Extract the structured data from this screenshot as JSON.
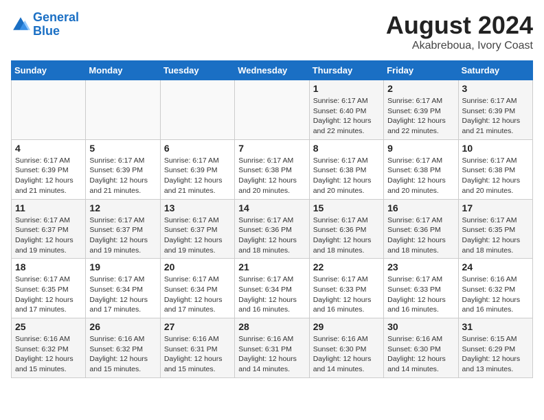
{
  "header": {
    "logo_line1": "General",
    "logo_line2": "Blue",
    "month_year": "August 2024",
    "location": "Akabreboua, Ivory Coast"
  },
  "weekdays": [
    "Sunday",
    "Monday",
    "Tuesday",
    "Wednesday",
    "Thursday",
    "Friday",
    "Saturday"
  ],
  "weeks": [
    [
      {
        "day": "",
        "info": ""
      },
      {
        "day": "",
        "info": ""
      },
      {
        "day": "",
        "info": ""
      },
      {
        "day": "",
        "info": ""
      },
      {
        "day": "1",
        "info": "Sunrise: 6:17 AM\nSunset: 6:40 PM\nDaylight: 12 hours\nand 22 minutes."
      },
      {
        "day": "2",
        "info": "Sunrise: 6:17 AM\nSunset: 6:39 PM\nDaylight: 12 hours\nand 22 minutes."
      },
      {
        "day": "3",
        "info": "Sunrise: 6:17 AM\nSunset: 6:39 PM\nDaylight: 12 hours\nand 21 minutes."
      }
    ],
    [
      {
        "day": "4",
        "info": "Sunrise: 6:17 AM\nSunset: 6:39 PM\nDaylight: 12 hours\nand 21 minutes."
      },
      {
        "day": "5",
        "info": "Sunrise: 6:17 AM\nSunset: 6:39 PM\nDaylight: 12 hours\nand 21 minutes."
      },
      {
        "day": "6",
        "info": "Sunrise: 6:17 AM\nSunset: 6:39 PM\nDaylight: 12 hours\nand 21 minutes."
      },
      {
        "day": "7",
        "info": "Sunrise: 6:17 AM\nSunset: 6:38 PM\nDaylight: 12 hours\nand 20 minutes."
      },
      {
        "day": "8",
        "info": "Sunrise: 6:17 AM\nSunset: 6:38 PM\nDaylight: 12 hours\nand 20 minutes."
      },
      {
        "day": "9",
        "info": "Sunrise: 6:17 AM\nSunset: 6:38 PM\nDaylight: 12 hours\nand 20 minutes."
      },
      {
        "day": "10",
        "info": "Sunrise: 6:17 AM\nSunset: 6:38 PM\nDaylight: 12 hours\nand 20 minutes."
      }
    ],
    [
      {
        "day": "11",
        "info": "Sunrise: 6:17 AM\nSunset: 6:37 PM\nDaylight: 12 hours\nand 19 minutes."
      },
      {
        "day": "12",
        "info": "Sunrise: 6:17 AM\nSunset: 6:37 PM\nDaylight: 12 hours\nand 19 minutes."
      },
      {
        "day": "13",
        "info": "Sunrise: 6:17 AM\nSunset: 6:37 PM\nDaylight: 12 hours\nand 19 minutes."
      },
      {
        "day": "14",
        "info": "Sunrise: 6:17 AM\nSunset: 6:36 PM\nDaylight: 12 hours\nand 18 minutes."
      },
      {
        "day": "15",
        "info": "Sunrise: 6:17 AM\nSunset: 6:36 PM\nDaylight: 12 hours\nand 18 minutes."
      },
      {
        "day": "16",
        "info": "Sunrise: 6:17 AM\nSunset: 6:36 PM\nDaylight: 12 hours\nand 18 minutes."
      },
      {
        "day": "17",
        "info": "Sunrise: 6:17 AM\nSunset: 6:35 PM\nDaylight: 12 hours\nand 18 minutes."
      }
    ],
    [
      {
        "day": "18",
        "info": "Sunrise: 6:17 AM\nSunset: 6:35 PM\nDaylight: 12 hours\nand 17 minutes."
      },
      {
        "day": "19",
        "info": "Sunrise: 6:17 AM\nSunset: 6:34 PM\nDaylight: 12 hours\nand 17 minutes."
      },
      {
        "day": "20",
        "info": "Sunrise: 6:17 AM\nSunset: 6:34 PM\nDaylight: 12 hours\nand 17 minutes."
      },
      {
        "day": "21",
        "info": "Sunrise: 6:17 AM\nSunset: 6:34 PM\nDaylight: 12 hours\nand 16 minutes."
      },
      {
        "day": "22",
        "info": "Sunrise: 6:17 AM\nSunset: 6:33 PM\nDaylight: 12 hours\nand 16 minutes."
      },
      {
        "day": "23",
        "info": "Sunrise: 6:17 AM\nSunset: 6:33 PM\nDaylight: 12 hours\nand 16 minutes."
      },
      {
        "day": "24",
        "info": "Sunrise: 6:16 AM\nSunset: 6:32 PM\nDaylight: 12 hours\nand 16 minutes."
      }
    ],
    [
      {
        "day": "25",
        "info": "Sunrise: 6:16 AM\nSunset: 6:32 PM\nDaylight: 12 hours\nand 15 minutes."
      },
      {
        "day": "26",
        "info": "Sunrise: 6:16 AM\nSunset: 6:32 PM\nDaylight: 12 hours\nand 15 minutes."
      },
      {
        "day": "27",
        "info": "Sunrise: 6:16 AM\nSunset: 6:31 PM\nDaylight: 12 hours\nand 15 minutes."
      },
      {
        "day": "28",
        "info": "Sunrise: 6:16 AM\nSunset: 6:31 PM\nDaylight: 12 hours\nand 14 minutes."
      },
      {
        "day": "29",
        "info": "Sunrise: 6:16 AM\nSunset: 6:30 PM\nDaylight: 12 hours\nand 14 minutes."
      },
      {
        "day": "30",
        "info": "Sunrise: 6:16 AM\nSunset: 6:30 PM\nDaylight: 12 hours\nand 14 minutes."
      },
      {
        "day": "31",
        "info": "Sunrise: 6:15 AM\nSunset: 6:29 PM\nDaylight: 12 hours\nand 13 minutes."
      }
    ]
  ]
}
